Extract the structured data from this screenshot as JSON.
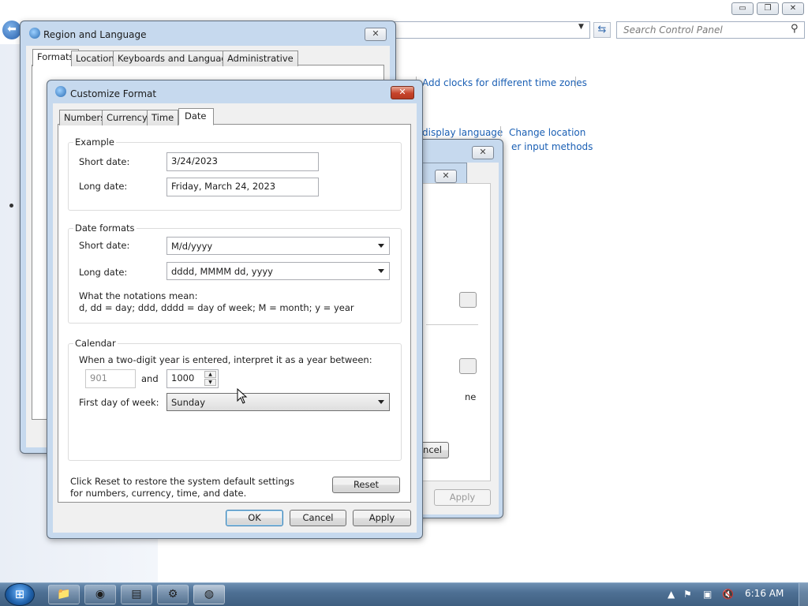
{
  "control_panel": {
    "search_placeholder": "Search Control Panel",
    "links": {
      "add_clocks": "Add clocks for different time zones",
      "display_language": "display language",
      "change_location": "Change location",
      "input_methods": "er input methods"
    },
    "caption_buttons": {
      "minimize": "▭",
      "maximize": "❐",
      "close": "✕"
    }
  },
  "region_window": {
    "title": "Region and Language",
    "tabs": [
      "Formats",
      "Location",
      "Keyboards and Languages",
      "Administrative"
    ]
  },
  "background_dialog": {
    "text_fragment": "ne",
    "cancel_fragment": "ncel",
    "apply_label": "Apply"
  },
  "customize_format": {
    "title": "Customize Format",
    "tabs": [
      "Numbers",
      "Currency",
      "Time",
      "Date"
    ],
    "selected_tab": "Date",
    "example": {
      "group_label": "Example",
      "short_label": "Short date:",
      "short_value": "3/24/2023",
      "long_label": "Long date:",
      "long_value": "Friday, March 24, 2023"
    },
    "formats": {
      "group_label": "Date formats",
      "short_label": "Short date:",
      "short_value": "M/d/yyyy",
      "long_label": "Long date:",
      "long_value": "dddd, MMMM dd, yyyy",
      "notation_heading": "What the notations mean:",
      "notation_text": "d, dd = day;  ddd, dddd = day of week;  M = month;  y = year"
    },
    "calendar": {
      "group_label": "Calendar",
      "two_digit_text": "When a two-digit year is entered, interpret it as a year between:",
      "year_from": "901",
      "and_label": "and",
      "year_to": "1000",
      "first_day_label": "First day of week:",
      "first_day_value": "Sunday"
    },
    "reset_text": "Click Reset to restore the system default settings for numbers, currency, time, and date.",
    "reset_label": "Reset",
    "ok_label": "OK",
    "cancel_label": "Cancel",
    "apply_label": "Apply"
  },
  "taskbar": {
    "time": "6:16 AM",
    "tray_arrow": "▲"
  }
}
